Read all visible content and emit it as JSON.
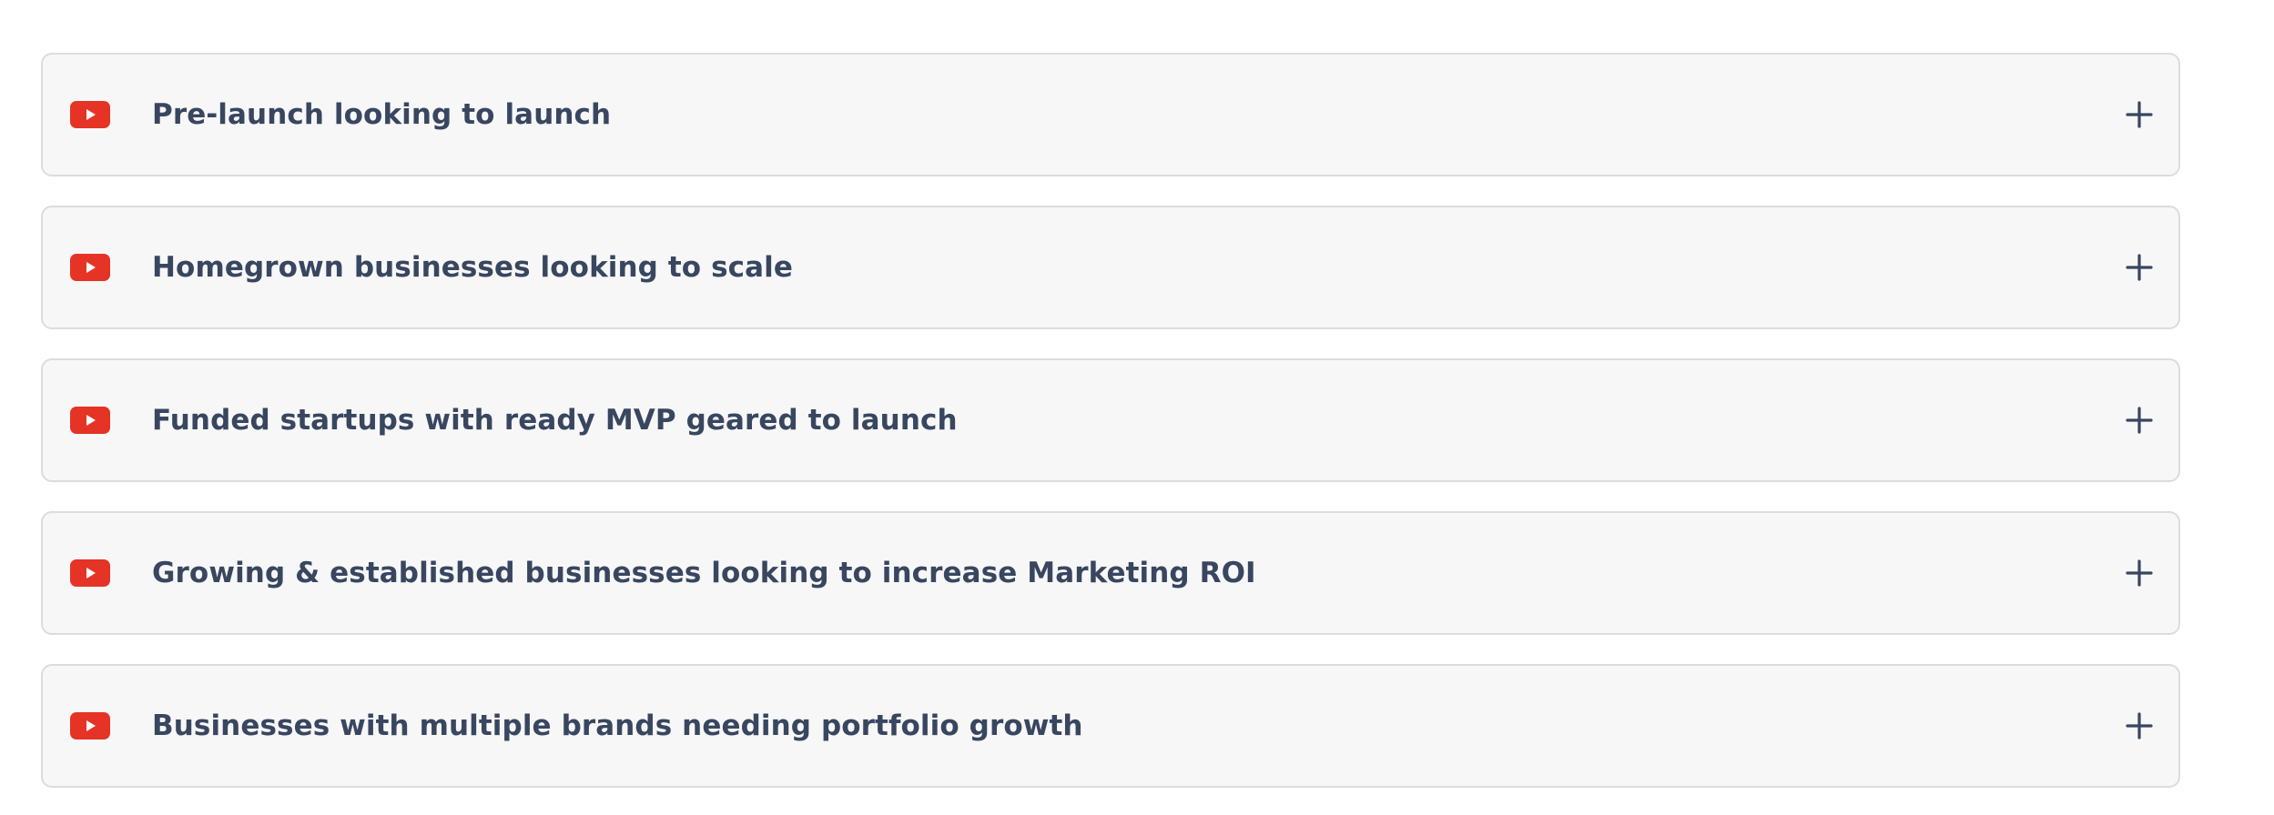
{
  "colors": {
    "panel_bg": "#f7f7f7",
    "panel_border": "#dcdcdc",
    "text": "#384660",
    "play_icon": "#e53326"
  },
  "accordion": {
    "items": [
      {
        "label": "Pre-launch looking to launch",
        "icon": "youtube-play-icon",
        "toggle_icon": "plus-icon"
      },
      {
        "label": "Homegrown businesses looking to scale",
        "icon": "youtube-play-icon",
        "toggle_icon": "plus-icon"
      },
      {
        "label": "Funded startups with ready MVP geared to launch",
        "icon": "youtube-play-icon",
        "toggle_icon": "plus-icon"
      },
      {
        "label": "Growing & established businesses looking to increase Marketing ROI",
        "icon": "youtube-play-icon",
        "toggle_icon": "plus-icon"
      },
      {
        "label": "Businesses with multiple brands needing portfolio growth",
        "icon": "youtube-play-icon",
        "toggle_icon": "plus-icon"
      }
    ]
  }
}
